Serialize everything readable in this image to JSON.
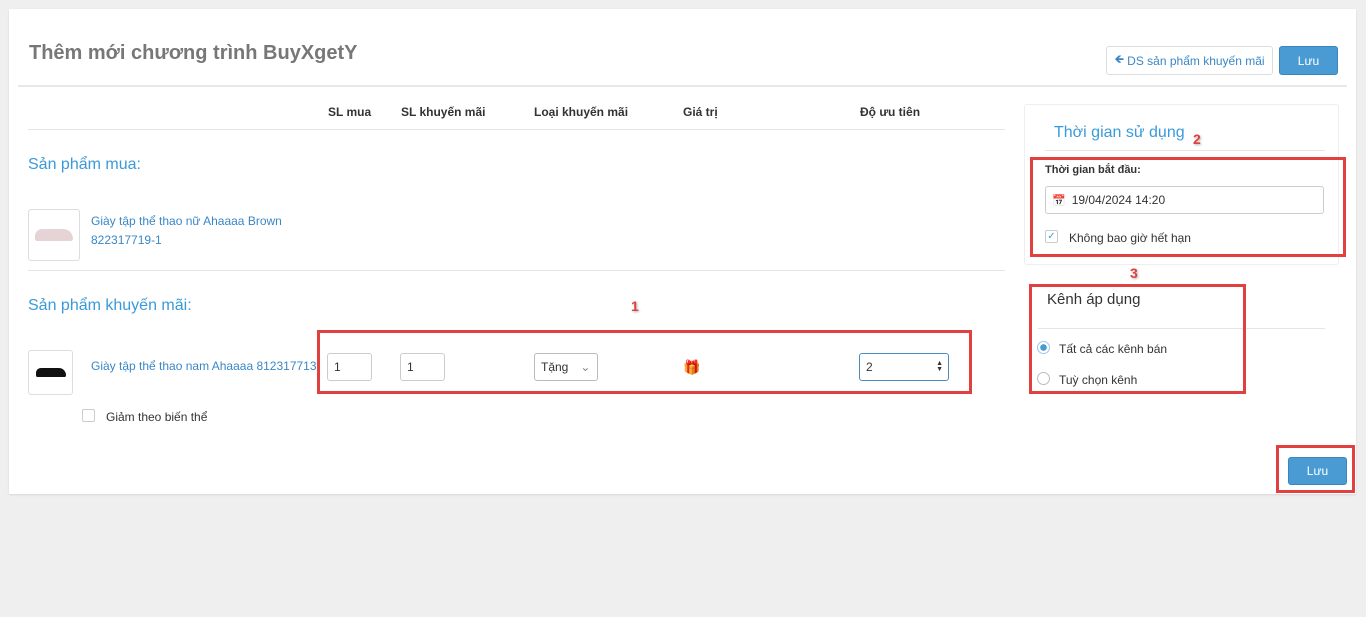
{
  "header": {
    "title": "Thêm mới chương trình BuyXgetY",
    "back_button": "DS sản phẩm khuyến mãi",
    "save_label": "Lưu"
  },
  "table": {
    "columns": [
      "SL mua",
      "SL khuyến mãi",
      "Loại khuyến mãi",
      "Giá trị",
      "Độ ưu tiên"
    ]
  },
  "buy_section": {
    "title": "Sản phẩm mua:",
    "product": {
      "name": "Giày tập thể thao nữ Ahaaaa Brown",
      "code": "822317719-1"
    }
  },
  "promo_section": {
    "title": "Sản phẩm khuyến mãi:",
    "product": {
      "name": "Giày tập thể thao nam Ahaaaa 812317713-",
      "sl_mua": "1",
      "sl_khuyen_mai": "1",
      "loai": "Tặng",
      "uu_tien": "2"
    },
    "variant_checkbox": "Giảm theo biến thể",
    "variant_checked": false
  },
  "time_panel": {
    "title": "Thời gian sử dụng",
    "start_label": "Thời gian bắt đầu:",
    "start_value": "19/04/2024 14:20",
    "never_expire": "Không bao giờ hết hạn",
    "never_expire_checked": true
  },
  "channel_panel": {
    "title": "Kênh áp dụng",
    "options": [
      "Tất cả các kênh bán",
      "Tuỳ chọn kênh"
    ],
    "selected": 0
  },
  "footer": {
    "save_label": "Lưu"
  },
  "annotations": [
    "1",
    "2",
    "3"
  ],
  "colors": {
    "accent": "#4a9bd4",
    "annotation": "#e0403f"
  }
}
